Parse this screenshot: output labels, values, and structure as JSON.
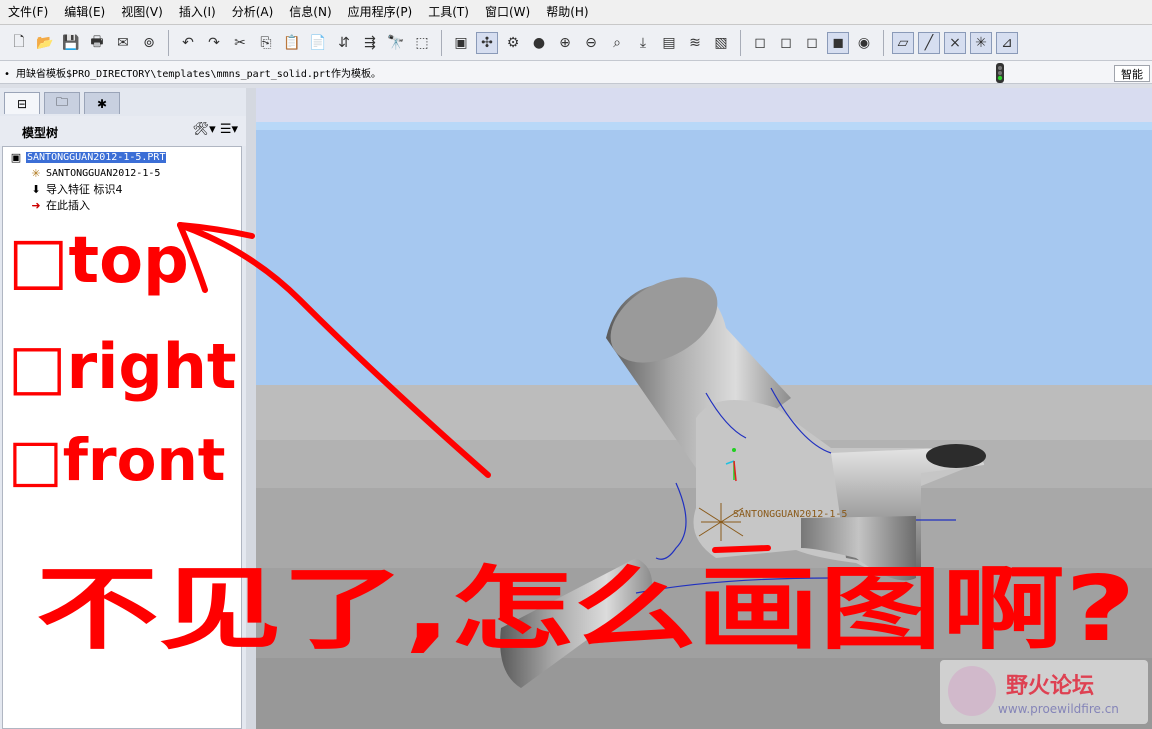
{
  "menu": [
    "文件(F)",
    "编辑(E)",
    "视图(V)",
    "插入(I)",
    "分析(A)",
    "信息(N)",
    "应用程序(P)",
    "工具(T)",
    "窗口(W)",
    "帮助(H)"
  ],
  "message": "• 用缺省模板$PRO_DIRECTORY\\templates\\mmns_part_solid.prt作为模板。",
  "smart_filter": "智能",
  "model_tree": {
    "title": "模型树",
    "items": [
      {
        "label": "SANTONGGUAN2012-1-5.PRT",
        "icon": "part-icon",
        "selected": true
      },
      {
        "label": "SANTONGGUAN2012-1-5",
        "icon": "csys-icon",
        "selected": false
      },
      {
        "label": "导入特征 标识4",
        "icon": "import-feature-icon",
        "selected": false
      },
      {
        "label": "在此插入",
        "icon": "insert-here-arrow-icon",
        "selected": false
      }
    ]
  },
  "viewport": {
    "feature_label": "SANTONGGUAN2012-1-5",
    "bg_top": "#a6c8f0",
    "bg_floor": "#b8b8b8"
  },
  "annotation": {
    "lines": [
      "□top",
      "□right",
      "□front"
    ],
    "question": "不见了,怎么画图啊?",
    "color": "#ff0000"
  },
  "watermark": {
    "title": "野火论坛",
    "url": "www.proewildfire.cn"
  }
}
